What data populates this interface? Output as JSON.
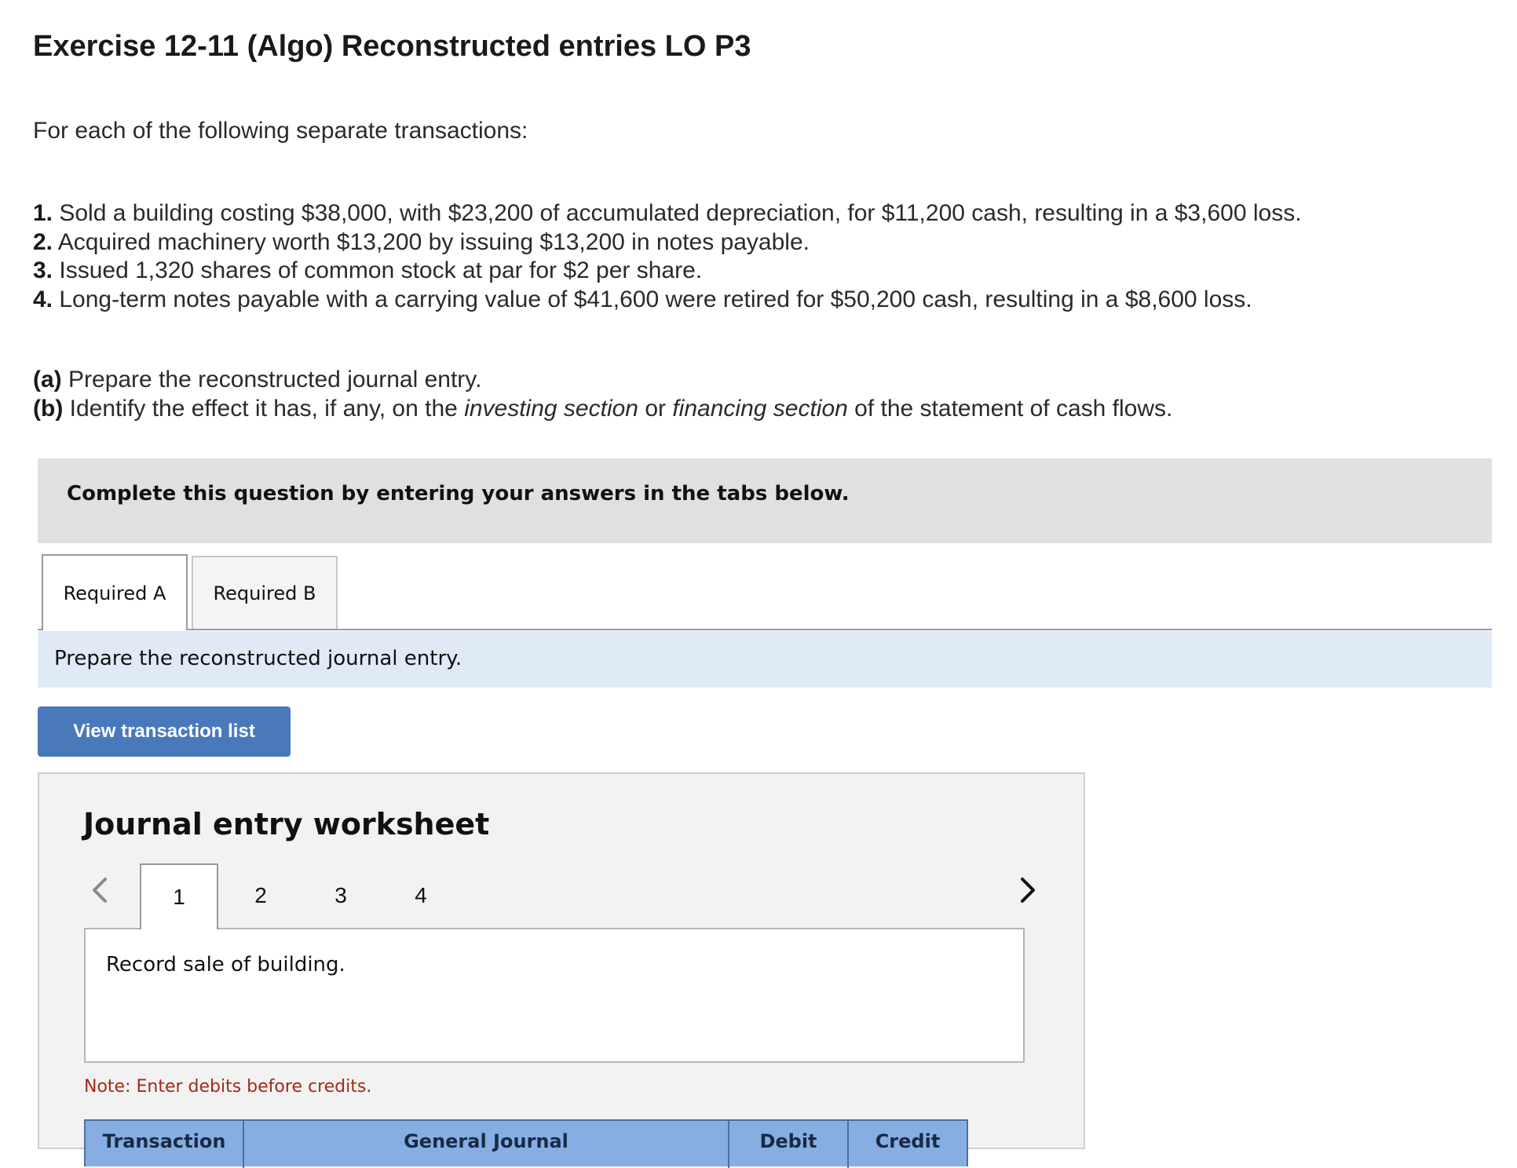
{
  "title": "Exercise 12-11 (Algo) Reconstructed entries LO P3",
  "intro": "For each of the following separate transactions:",
  "transactions": [
    {
      "num": "1.",
      "text": " Sold a building costing $38,000, with $23,200 of accumulated depreciation, for $11,200 cash, resulting in a $3,600 loss."
    },
    {
      "num": "2.",
      "text": " Acquired machinery worth $13,200 by issuing $13,200 in notes payable."
    },
    {
      "num": "3.",
      "text": " Issued 1,320 shares of common stock at par for $2 per share."
    },
    {
      "num": "4.",
      "text": " Long-term notes payable with a carrying value of $41,600 were retired for $50,200 cash, resulting in a $8,600 loss."
    }
  ],
  "tasks": {
    "a": {
      "label": "(a)",
      "text": " Prepare the reconstructed journal entry."
    },
    "b": {
      "label": "(b)",
      "pre": " Identify the effect it has, if any, on the ",
      "em1": "investing section",
      "mid": " or ",
      "em2": "financing section",
      "post": " of the statement of cash flows."
    }
  },
  "instructions": "Complete this question by entering your answers in the tabs below.",
  "req_tabs": [
    "Required A",
    "Required B"
  ],
  "active_tab_prompt": "Prepare the reconstructed journal entry.",
  "view_button": "View transaction list",
  "worksheet": {
    "title": "Journal entry worksheet",
    "steps": [
      "1",
      "2",
      "3",
      "4"
    ],
    "active_step": "1",
    "description": "Record sale of building.",
    "note": "Note: Enter debits before credits.",
    "columns": [
      "Transaction",
      "General Journal",
      "Debit",
      "Credit"
    ],
    "icons": {
      "prev": "chevron-left-icon",
      "next": "chevron-right-icon"
    }
  },
  "colors": {
    "button": "#4a79bb",
    "banner": "#dfeaf6",
    "header_fill": "#86aee3",
    "note": "#a02a1a"
  }
}
